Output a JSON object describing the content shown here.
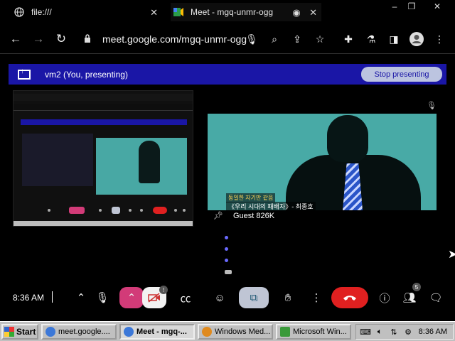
{
  "browser": {
    "tabs": [
      {
        "title": "file:///",
        "icon": "globe-icon",
        "close": "✕"
      },
      {
        "title": "Meet - mgq-unmr-ogg",
        "icon": "meet-icon",
        "close": "✕"
      }
    ],
    "window_controls": {
      "minimize": "–",
      "restore": "❐",
      "close": "✕"
    },
    "url": "meet.google.com/mgq-unmr-ogg"
  },
  "banner": {
    "title": "vm2 (You, presenting)",
    "stop_label": "Stop presenting"
  },
  "video": {
    "caption_line1": "동일한 자기만 같음",
    "caption_line2": "《우리 시대의 패배자》- 최종호"
  },
  "participant": {
    "name": "Guest 826K"
  },
  "meet_controls": {
    "time": "8:36 AM",
    "people_count": "5"
  },
  "taskbar": {
    "start_label": "Start",
    "tasks": [
      {
        "label": "meet.google....",
        "active": false,
        "color": "#3c78d8"
      },
      {
        "label": "Meet - mgq-...",
        "active": true,
        "color": "#3c78d8"
      },
      {
        "label": "Windows Med...",
        "active": false,
        "color": "#e08a1e"
      },
      {
        "label": "Microsoft Win...",
        "active": false,
        "color": "#3a9a3a"
      }
    ],
    "clock": "8:36 AM"
  },
  "colors": {
    "banner_bg": "#1a16a6",
    "hangup": "#e02020",
    "mic_pill": "#d23b78",
    "video_bg": "#48aaa6"
  }
}
